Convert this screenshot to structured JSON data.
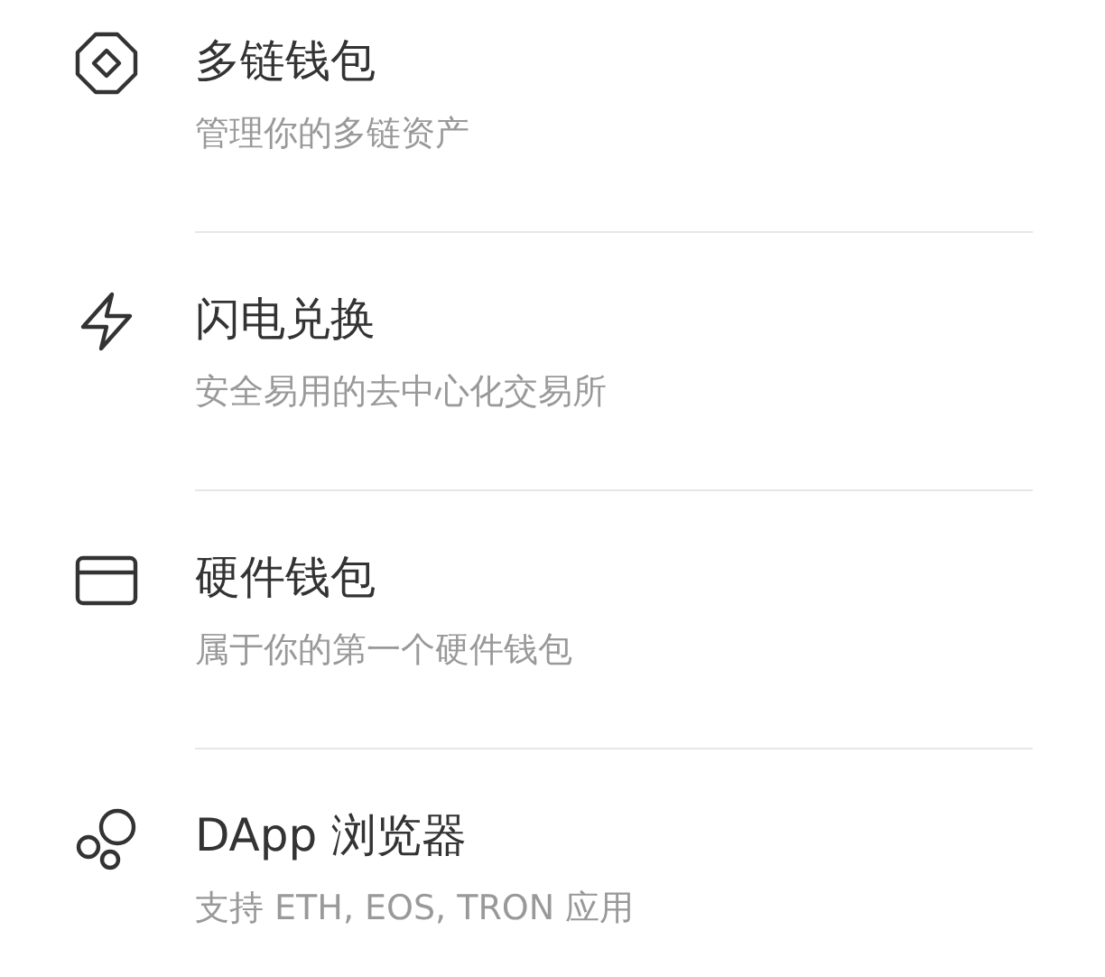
{
  "items": [
    {
      "kind": "wallet",
      "title": "多链钱包",
      "subtitle": "管理你的多链资产"
    },
    {
      "kind": "swap",
      "title": "闪电兑换",
      "subtitle": "安全易用的去中心化交易所"
    },
    {
      "kind": "hardware",
      "title": "硬件钱包",
      "subtitle": "属于你的第一个硬件钱包"
    },
    {
      "kind": "dapp",
      "title": "DApp 浏览器",
      "subtitle": "支持 ETH, EOS, TRON 应用"
    }
  ]
}
